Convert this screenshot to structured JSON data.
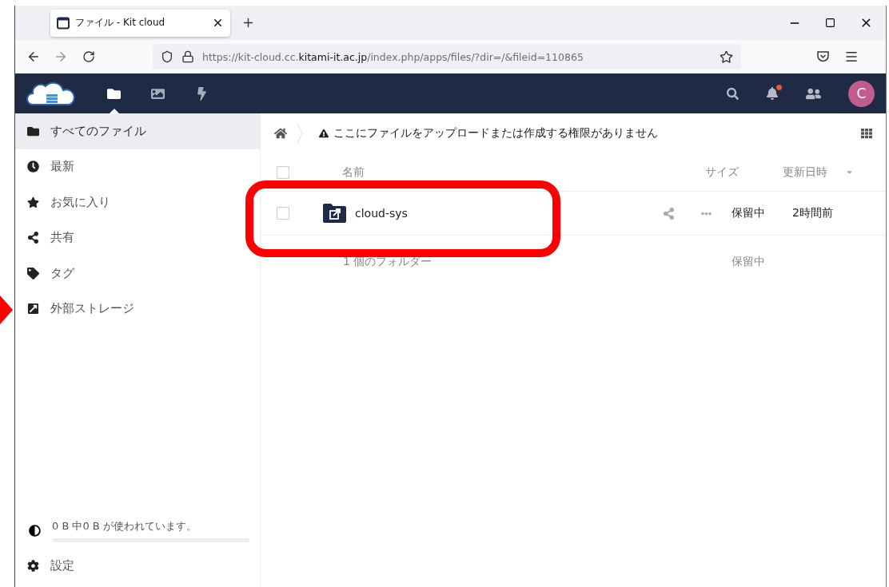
{
  "browser": {
    "tab_title": "ファイル - Kit cloud",
    "url": "https://kit-cloud.cc.**kitami-it.ac.jp**/index.php/apps/files/?dir=/&fileid=110865"
  },
  "header": {
    "apps": [
      {
        "selected": true
      },
      {
        "selected": false
      },
      {
        "selected": false
      }
    ],
    "notification_unread": true,
    "avatar": "C"
  },
  "sidebar": {
    "items": [
      {
        "label": "すべてのファイル",
        "selected": true
      },
      {
        "label": "最新",
        "selected": false
      },
      {
        "label": "お気に入り",
        "selected": false
      },
      {
        "label": "共有",
        "selected": false
      },
      {
        "label": "タグ",
        "selected": false
      },
      {
        "label": "外部ストレージ",
        "selected": false
      }
    ],
    "quota": {
      "text": "0 B 中0 B が使われています。",
      "level": 0
    },
    "settings": "設定"
  },
  "notice": "ここにファイルをアップロードまたは作成する権限がありません",
  "table": {
    "all_checked": false,
    "columns": [
      "名前",
      "サイズ",
      "更新日時"
    ],
    "rows": [
      {
        "name": "cloud-sys",
        "size": "保留中",
        "modified": "2時間前",
        "checked": false
      }
    ],
    "summary": {
      "count": "1 個のフォルダー",
      "size": "保留中"
    }
  }
}
